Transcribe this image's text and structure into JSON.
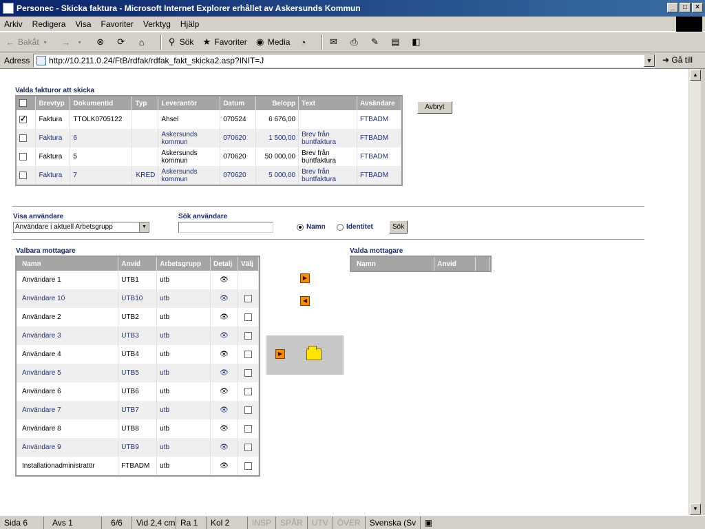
{
  "window": {
    "title": "Personec - Skicka faktura - Microsoft Internet Explorer erhållet av Askersunds Kommun"
  },
  "menu": [
    "Arkiv",
    "Redigera",
    "Visa",
    "Favoriter",
    "Verktyg",
    "Hjälp"
  ],
  "toolbar": {
    "back": "Bakåt",
    "search": "Sök",
    "favorites": "Favoriter",
    "media": "Media"
  },
  "address": {
    "label": "Adress",
    "url": "http://10.211.0.24/FtB/rdfak/rdfak_fakt_skicka2.asp?INIT=J",
    "go": "Gå till"
  },
  "invoices": {
    "title": "Valda fakturor att skicka",
    "cancel_label": "Avbryt",
    "columns": [
      "Brevtyp",
      "Dokumentid",
      "Typ",
      "Leverantör",
      "Datum",
      "Belopp",
      "Text",
      "Avsändare"
    ],
    "rows": [
      {
        "brevtyp": "Faktura",
        "dokumentid": "TTOLK0705122",
        "typ": "",
        "leverantor": "Ahsel",
        "datum": "070524",
        "belopp": "6 676,00",
        "text": "",
        "avsandare": "FTBADM",
        "checked": true
      },
      {
        "brevtyp": "Faktura",
        "dokumentid": "6",
        "typ": "",
        "leverantor": "Askersunds kommun",
        "datum": "070620",
        "belopp": "1 500,00",
        "text": "Brev från buntfaktura",
        "avsandare": "FTBADM",
        "checked": false
      },
      {
        "brevtyp": "Faktura",
        "dokumentid": "5",
        "typ": "",
        "leverantor": "Askersunds kommun",
        "datum": "070620",
        "belopp": "50 000,00",
        "text": "Brev från buntfaktura",
        "avsandare": "FTBADM",
        "checked": false
      },
      {
        "brevtyp": "Faktura",
        "dokumentid": "7",
        "typ": "KRED",
        "leverantor": "Askersunds kommun",
        "datum": "070620",
        "belopp": "5 000,00",
        "text": "Brev från buntfaktura",
        "avsandare": "FTBADM",
        "checked": false
      }
    ]
  },
  "filters": {
    "show_users_label": "Visa användare",
    "show_users_value": "Användare i aktuell Arbetsgrupp",
    "search_users_label": "Sök användare",
    "search_value": "",
    "radio_name": "Namn",
    "radio_identity": "Identitet",
    "search_button": "Sök"
  },
  "available": {
    "title": "Valbara mottagare",
    "columns": [
      "Namn",
      "Anvid",
      "Arbetsgrupp",
      "Detalj",
      "Välj"
    ],
    "rows": [
      {
        "namn": "Användare 1",
        "anvid": "UTB1",
        "grupp": "utb",
        "checkbox": false
      },
      {
        "namn": "Användare 10",
        "anvid": "UTB10",
        "grupp": "utb",
        "checkbox": true
      },
      {
        "namn": "Användare 2",
        "anvid": "UTB2",
        "grupp": "utb",
        "checkbox": true
      },
      {
        "namn": "Användare 3",
        "anvid": "UTB3",
        "grupp": "utb",
        "checkbox": true
      },
      {
        "namn": "Användare 4",
        "anvid": "UTB4",
        "grupp": "utb",
        "checkbox": true
      },
      {
        "namn": "Användare 5",
        "anvid": "UTB5",
        "grupp": "utb",
        "checkbox": true
      },
      {
        "namn": "Användare 6",
        "anvid": "UTB6",
        "grupp": "utb",
        "checkbox": true
      },
      {
        "namn": "Användare 7",
        "anvid": "UTB7",
        "grupp": "utb",
        "checkbox": true
      },
      {
        "namn": "Användare 8",
        "anvid": "UTB8",
        "grupp": "utb",
        "checkbox": true
      },
      {
        "namn": "Användare 9",
        "anvid": "UTB9",
        "grupp": "utb",
        "checkbox": true
      },
      {
        "namn": "Installationadministratör",
        "anvid": "FTBADM",
        "grupp": "utb",
        "checkbox": true
      }
    ]
  },
  "selected": {
    "title": "Valda mottagare",
    "columns": [
      "Namn",
      "Anvid"
    ]
  },
  "status": {
    "page": "Sida 6",
    "section": "Avs 1",
    "pages": "6/6",
    "pos": "Vid 2,4 cm",
    "line": "Ra 1",
    "col": "Kol 2",
    "insp": "INSP",
    "spar": "SPÅR",
    "utv": "UTV",
    "over": "ÖVER",
    "lang": "Svenska (Sv"
  }
}
